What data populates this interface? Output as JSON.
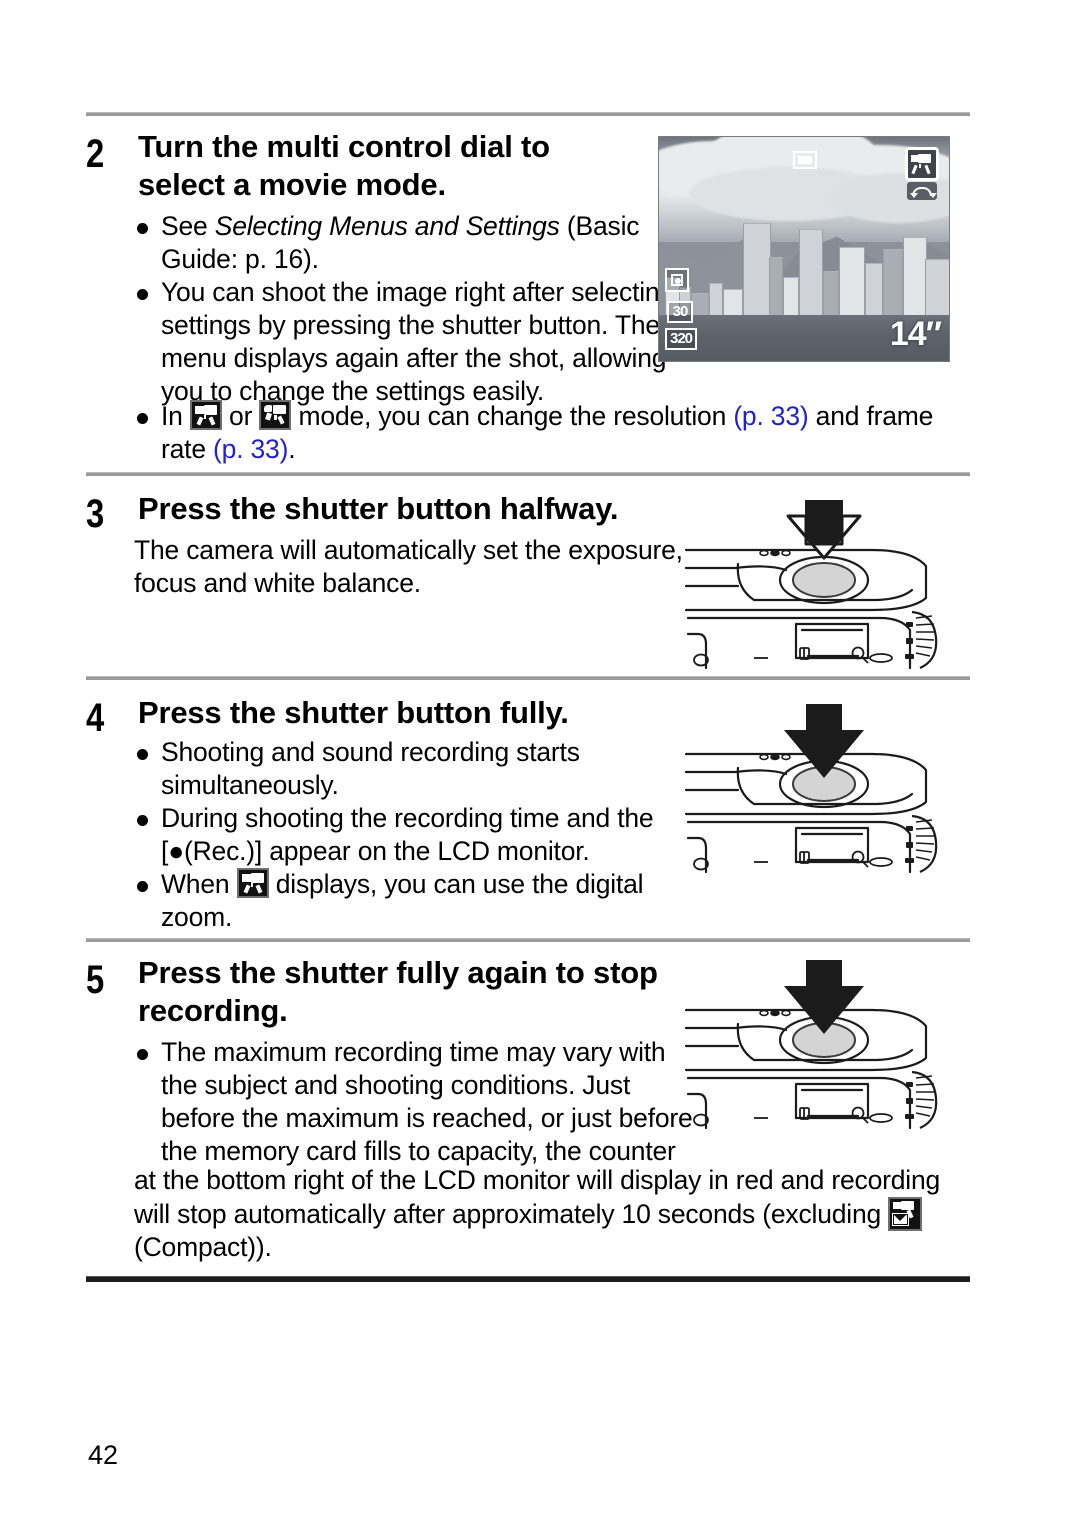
{
  "page": {
    "number": "42"
  },
  "steps": [
    {
      "number": "2",
      "heading_line1": "Turn the multi control dial to",
      "heading_line2": "select a movie mode.",
      "bullets": [
        {
          "pre": "See ",
          "italic": "Selecting Menus and Settings",
          "post": " (Basic Guide: p. 16)."
        },
        {
          "text": "You can shoot the image right after selecting settings by pressing the shutter button. The menu displays again after the shot, allowing you to change the settings easily."
        },
        {
          "seg1": "In ",
          "icon1": "movie-standard-icon",
          "seg2": " or ",
          "icon2": "movie-compact-icon",
          "seg3": " mode, you can change the resolution ",
          "link1": "(p. 33)",
          "seg4": " and frame rate ",
          "link2": "(p. 33)",
          "seg5": "."
        }
      ]
    },
    {
      "number": "3",
      "heading_line1": "Press the shutter button halfway.",
      "body_line1": "The camera will automatically set the exposure,",
      "body_line2": "focus and white balance.",
      "arrow": "hollow-down-arrow"
    },
    {
      "number": "4",
      "heading_line1": "Press the shutter button fully.",
      "bullets": [
        {
          "text": "Shooting and sound recording starts simultaneously."
        },
        {
          "text": "During shooting the recording time and the [●(Rec.)] appear on the LCD monitor."
        },
        {
          "seg1": " When ",
          "icon1": "movie-standard-icon",
          "seg2": " displays, you can use the digital zoom."
        }
      ],
      "arrow": "solid-down-arrow"
    },
    {
      "number": "5",
      "heading_line1": "Press the shutter fully again to stop",
      "heading_line2": "recording.",
      "bullets": [
        {
          "seg1": "The maximum recording time may vary with the subject and shooting conditions. Just before the maximum is reached, or just before the memory card fills to capacity, the counter",
          "seg_wide": "at the bottom right of the LCD monitor will display in red and recording will stop automatically after approximately 10 seconds (excluding ",
          "icon1": "movie-compact-mail-icon",
          "seg3": " (Compact))."
        }
      ],
      "arrow": "solid-down-arrow"
    }
  ],
  "lcd_preview": {
    "alt": "camera LCD monitor showing city skyline with movie mode icons",
    "af_frame": "af-frame-icon",
    "mode_badge": "movie-mode-badge-icon",
    "rotate_badge": "rotate-dial-icon",
    "metering": "metering-icon",
    "frame_rate": "30",
    "resolution": "320",
    "time_remaining": "14″"
  },
  "camera_figures": {
    "shutter_button_label": "shutter-button",
    "zoom_lever_label": "zoom-lever",
    "mode_dial_label": "mode-dial"
  },
  "colors": {
    "link": "#2222cc",
    "rule": "#9a9a9a",
    "rule_thick": "#1c1c1c",
    "text": "#000000"
  }
}
